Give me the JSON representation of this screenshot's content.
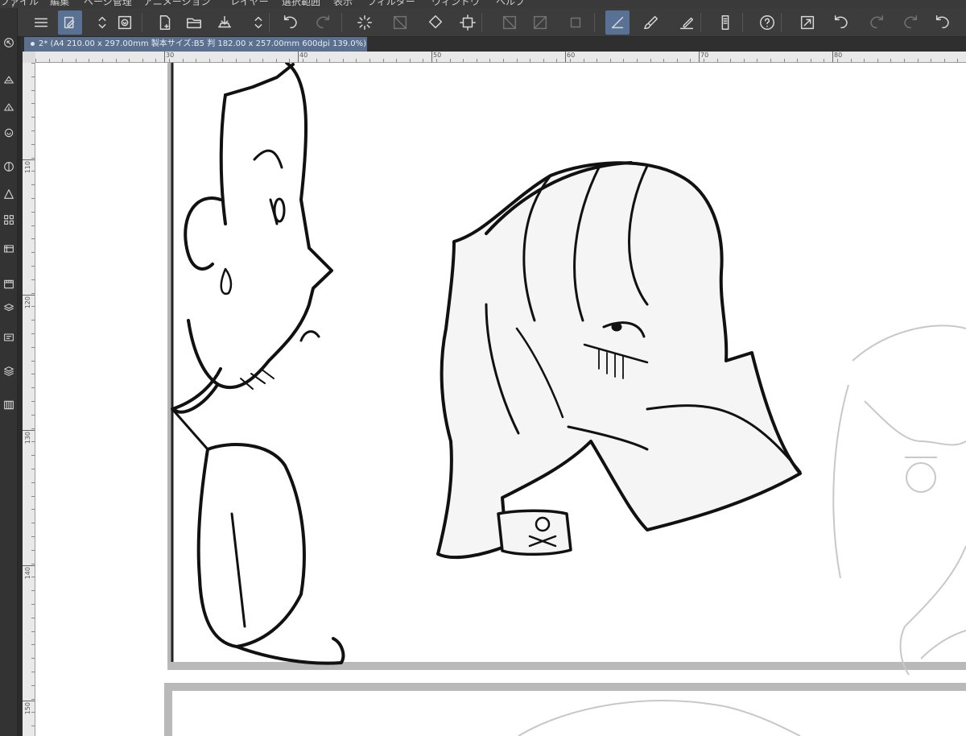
{
  "menu": [
    "ファイル",
    "編集",
    "ページ管理",
    "アニメーション",
    "レイヤー",
    "選択範囲",
    "表示",
    "フィルター",
    "ウィンドウ",
    "ヘルプ"
  ],
  "toolbar": {
    "items": [
      {
        "name": "menu-icon",
        "active": false,
        "dim": false
      },
      {
        "name": "edit-mode-icon",
        "active": true,
        "dim": false
      },
      {
        "name": "stepper-icon",
        "active": false,
        "dim": false
      },
      {
        "name": "spiral-icon",
        "active": false,
        "dim": false
      },
      {
        "name": "new-page-icon",
        "active": false,
        "dim": false
      },
      {
        "name": "open-folder-icon",
        "active": false,
        "dim": false
      },
      {
        "name": "save-icon",
        "active": false,
        "dim": false
      },
      {
        "name": "stepper-icon",
        "active": false,
        "dim": false
      },
      {
        "name": "undo-icon",
        "active": false,
        "dim": false
      },
      {
        "name": "redo-icon",
        "active": false,
        "dim": true
      },
      {
        "name": "loading-icon",
        "active": false,
        "dim": false
      },
      {
        "name": "deselect-icon",
        "active": false,
        "dim": true
      },
      {
        "name": "fill-icon",
        "active": false,
        "dim": false
      },
      {
        "name": "transform-icon",
        "active": false,
        "dim": false
      },
      {
        "name": "hide-selection-icon",
        "active": false,
        "dim": true
      },
      {
        "name": "invert-selection-icon",
        "active": false,
        "dim": true
      },
      {
        "name": "crop-icon",
        "active": false,
        "dim": true
      },
      {
        "name": "snap-ruler-icon",
        "active": true,
        "dim": false
      },
      {
        "name": "brush-icon",
        "active": false,
        "dim": false
      },
      {
        "name": "ruler-pen-icon",
        "active": false,
        "dim": false
      },
      {
        "name": "device-icon",
        "active": false,
        "dim": false
      },
      {
        "name": "help-icon",
        "active": false,
        "dim": false
      },
      {
        "name": "expand-icon",
        "active": false,
        "dim": false
      },
      {
        "name": "rotate-left-icon",
        "active": false,
        "dim": false
      },
      {
        "name": "redo-icon",
        "active": false,
        "dim": true
      },
      {
        "name": "redo-icon",
        "active": false,
        "dim": true
      },
      {
        "name": "undo-icon",
        "active": false,
        "dim": false
      }
    ]
  },
  "document": {
    "tab_label": "2* (A4 210.00 x 297.00mm 製本サイズ:B5 判 182.00 x 257.00mm 600dpi 139.0%)"
  },
  "leftbar": {
    "items": [
      "navigator-icon",
      "tool-property-icon",
      "sub-tool-icon",
      "brush-size-icon",
      "color-wheel-icon",
      "color-set-icon",
      "intermediate-color-icon",
      "material-icon",
      "timeline-icon",
      "layer-property-icon",
      "layer-search-icon",
      "layer-icon",
      "page-manager-icon"
    ]
  },
  "rulers": {
    "horizontal": [
      "30",
      "40",
      "50",
      "60",
      "70",
      "80"
    ],
    "vertical": [
      "110",
      "120",
      "130",
      "140",
      "150"
    ]
  },
  "colors": {
    "active_tool": "#5a7196",
    "tab": "#5b6f8e",
    "toolbar": "#3c3c3c",
    "canvas": "#ffffff"
  }
}
